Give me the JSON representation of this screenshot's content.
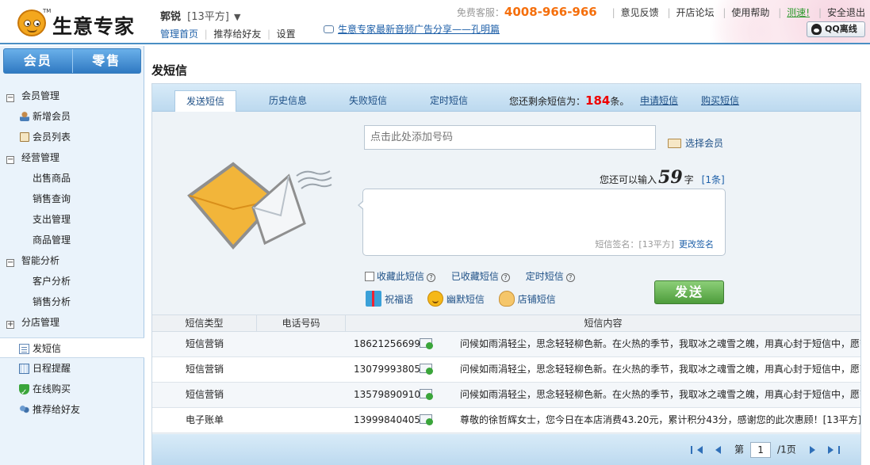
{
  "brand": {
    "tm": "TM",
    "name": "生意专家"
  },
  "user": {
    "name": "郭锐",
    "shop": "[13平方]",
    "caret": "▼"
  },
  "user_links": [
    "管理首页",
    "推荐给好友",
    "设置"
  ],
  "notice": "生意专家最新音频广告分享——孔明篇",
  "topbar": {
    "hotline_label": "免费客服：",
    "hotline": "4008-966-966",
    "links": [
      "意见反馈",
      "开店论坛",
      "使用帮助",
      "测速!",
      "安全退出"
    ],
    "qq_label": "QQ离线"
  },
  "sidebar": {
    "tabs": [
      "会员",
      "零售"
    ],
    "groups": [
      {
        "toggle": "−",
        "label": "会员管理",
        "items": [
          {
            "icon": "member-icon",
            "label": "新增会员"
          },
          {
            "icon": "card-icon",
            "label": "会员列表"
          }
        ]
      },
      {
        "toggle": "−",
        "label": "经营管理",
        "items": [
          {
            "label": "出售商品"
          },
          {
            "label": "销售查询"
          },
          {
            "label": "支出管理"
          },
          {
            "label": "商品管理"
          }
        ]
      },
      {
        "toggle": "−",
        "label": "智能分析",
        "items": [
          {
            "label": "客户分析"
          },
          {
            "label": "销售分析"
          }
        ]
      },
      {
        "toggle": "+",
        "label": "分店管理",
        "items": []
      }
    ],
    "bottom": [
      {
        "icon": "sms-icon",
        "label": "发短信",
        "active": true
      },
      {
        "icon": "calendar-icon",
        "label": "日程提醒"
      },
      {
        "icon": "shield-icon",
        "label": "在线购买"
      },
      {
        "icon": "people-icon",
        "label": "推荐给好友"
      }
    ]
  },
  "page": {
    "title": "发短信"
  },
  "tabs": [
    {
      "label": "发送短信",
      "active": true
    },
    {
      "label": "历史信息"
    },
    {
      "label": "失败短信"
    },
    {
      "label": "定时短信"
    }
  ],
  "quota": {
    "prefix": "您还剩余短信为：",
    "count": "184",
    "suffix": "条。",
    "apply": "申请短信",
    "buy": "购买短信"
  },
  "compose": {
    "phone_placeholder": "点击此处添加号码",
    "pick_member": "选择会员",
    "counter_prefix": "您还可以输入",
    "counter_num": "59",
    "counter_suffix": "字",
    "counter_pages": "[1条]",
    "signature_label": "短信签名：[13平方]",
    "edit_signature": "更改签名",
    "opt_collect": "收藏此短信",
    "opt_collected": "已收藏短信",
    "opt_scheduled": "定时短信",
    "quick_greeting": "祝福语",
    "quick_humor": "幽默短信",
    "quick_shop": "店铺短信",
    "send": "发送"
  },
  "table": {
    "headers": [
      "短信类型",
      "电话号码",
      "短信内容"
    ],
    "rows": [
      {
        "type": "短信营销",
        "phone": "18621256699",
        "content": "问候如雨涓轻尘，思念轻轻柳色新。在火热的季节，我取冰之魂雪之魄，用真心封于短信中，愿带给你清清凉凉的快乐。["
      },
      {
        "type": "短信营销",
        "phone": "13079993805",
        "content": "问候如雨涓轻尘，思念轻轻柳色新。在火热的季节，我取冰之魂雪之魄，用真心封于短信中，愿带给你清清凉凉的快乐。["
      },
      {
        "type": "短信营销",
        "phone": "13579890910",
        "content": "问候如雨涓轻尘，思念轻轻柳色新。在火热的季节，我取冰之魂雪之魄，用真心封于短信中，愿带给你清清凉凉的快乐。["
      },
      {
        "type": "电子账单",
        "phone": "13999840405",
        "content": "尊敬的徐哲辉女士，您今日在本店消费43.20元，累计积分43分，感谢您的此次惠顾！[13平方]"
      }
    ]
  },
  "pager": {
    "page_label": "第",
    "page": "1",
    "total": "/1页"
  }
}
